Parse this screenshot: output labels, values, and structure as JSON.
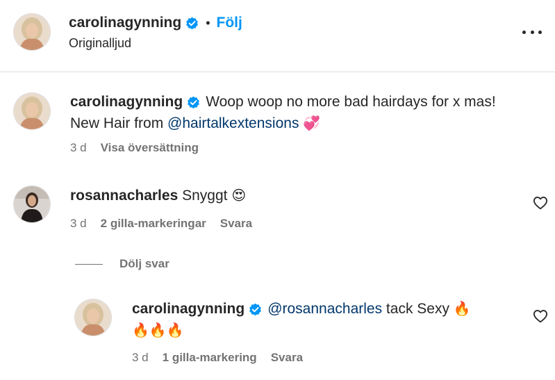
{
  "post_header": {
    "username": "carolinagynning",
    "separator": "•",
    "follow_label": "Följ",
    "audio_label": "Originalljud"
  },
  "caption": {
    "username": "carolinagynning",
    "text_part1": "Woop woop no more bad hairdays for x mas! New Hair from ",
    "mention": "@hairtalkextensions",
    "emoji": "💞",
    "time": "3 d",
    "translate_label": "Visa översättning"
  },
  "comments": [
    {
      "username": "rosannacharles",
      "text": "Snyggt",
      "emoji": "😍",
      "time": "3 d",
      "likes_label": "2 gilla-markeringar",
      "reply_label": "Svara"
    }
  ],
  "hide_replies_label": "Dölj svar",
  "reply": {
    "username": "carolinagynning",
    "mention": "@rosannacharles",
    "text": " tack Sexy ",
    "emoji_line1": "🔥",
    "emoji_line2": "🔥🔥🔥",
    "time": "3 d",
    "likes_label": "1 gilla-markering",
    "reply_label": "Svara"
  },
  "colors": {
    "link_blue": "#0095f6",
    "mention_blue": "#00376b",
    "secondary_text": "#737373",
    "verified_badge": "#0095f6"
  },
  "icons": {
    "verified": "verified-badge-icon",
    "more": "more-options-icon",
    "like": "heart-icon"
  }
}
